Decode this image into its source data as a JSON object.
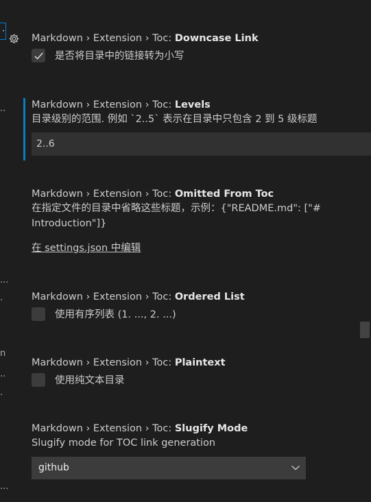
{
  "settings": [
    {
      "breadcrumb": "Markdown › Extension › Toc: ",
      "name": "Downcase Link",
      "checkbox_label": "是否将目录中的链接转为小写",
      "checked": true
    },
    {
      "breadcrumb": "Markdown › Extension › Toc: ",
      "name": "Levels",
      "description": "目录级别的范围. 例如 `2..5` 表示在目录中只包含 2 到 5 级标题",
      "value": "2..6"
    },
    {
      "breadcrumb": "Markdown › Extension › Toc: ",
      "name": "Omitted From Toc",
      "description_line1": "在指定文件的目录中省略这些标题，示例：{\"README.md\": [\"#",
      "description_line2": "Introduction\"]}",
      "edit_link": "在 settings.json 中编辑"
    },
    {
      "breadcrumb": "Markdown › Extension › Toc: ",
      "name": "Ordered List",
      "checkbox_label": "使用有序列表 (1. ..., 2. ...)",
      "checked": false
    },
    {
      "breadcrumb": "Markdown › Extension › Toc: ",
      "name": "Plaintext",
      "checkbox_label": "使用纯文本目录",
      "checked": false
    },
    {
      "breadcrumb": "Markdown › Extension › Toc: ",
      "name": "Slugify Mode",
      "description": "Slugify mode for TOC link generation",
      "selected": "github"
    }
  ],
  "gutter": {
    "focus_glyph": "·",
    "glyphs": [
      "..",
      "...",
      ".",
      "n",
      "..",
      ".",
      "..."
    ]
  },
  "colors": {
    "background": "#1e1e1e",
    "modified_indicator": "#0c7dbe",
    "focus_border": "#007fd4",
    "input_background": "#313131",
    "checkbox_background": "#3c3c3c"
  },
  "icons": {
    "gear": "gear-icon",
    "check": "check-icon",
    "dropdown": "chevron-down-icon"
  }
}
